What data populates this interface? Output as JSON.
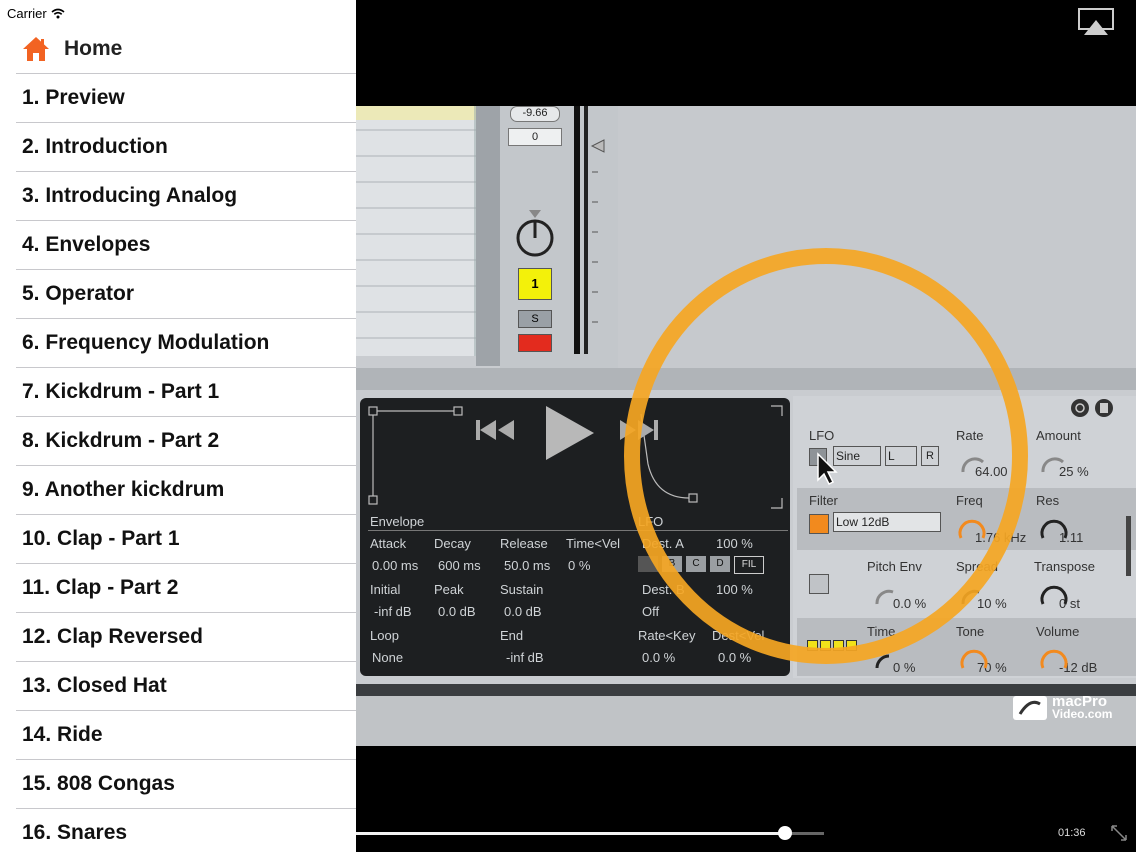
{
  "statusbar": {
    "carrier": "Carrier"
  },
  "home": {
    "label": "Home"
  },
  "nav_items": [
    "1.  Preview",
    "2.  Introduction",
    "3.  Introducing Analog",
    "4.  Envelopes",
    "5.  Operator",
    "6.  Frequency Modulation",
    "7.  Kickdrum - Part 1",
    "8.  Kickdrum - Part 2",
    "9.  Another kickdrum",
    "10. Clap - Part 1",
    "11. Clap - Part 2",
    "12. Clap Reversed",
    "13. Closed Hat",
    "14. Ride",
    "15. 808 Congas",
    "16. Snares"
  ],
  "player": {
    "time": "01:36",
    "progress": 0.552,
    "colors": {
      "accent": "#ff6a00",
      "highlight_ring": "#f5a623"
    }
  },
  "video_content": {
    "db_readout": "-9.66",
    "value_box": "0",
    "track_number": "1",
    "solo": "S",
    "envelope": {
      "title": "Envelope",
      "attack_label": "Attack",
      "attack": "0.00 ms",
      "decay_label": "Decay",
      "decay": "600 ms",
      "release_label": "Release",
      "release": "50.0 ms",
      "timevel_label": "Time<Vel",
      "timevel": "0 %",
      "initial_label": "Initial",
      "initial": "-inf dB",
      "peak_label": "Peak",
      "peak": "0.0 dB",
      "sustain_label": "Sustain",
      "sustain": "0.0 dB",
      "loop_label": "Loop",
      "loop": "None",
      "end_label": "End",
      "end": "-inf dB"
    },
    "lfo_sub": {
      "title": "LFO",
      "dest_label": "Dest. A",
      "dest_val": "100 %",
      "buttons": [
        "B",
        "C",
        "D",
        "FIL"
      ],
      "dest_b_label": "Dest. B",
      "dest_b_val": "100 %",
      "off": "Off",
      "rate_key": "Rate<Key",
      "rate_key_val": "0.0 %",
      "dest_vel": "Dest<Vel",
      "dest_vel_val": "0.0 %"
    },
    "panel": {
      "lfo": "LFO",
      "wave": "Sine",
      "channel": "L",
      "r": "R",
      "rate_label": "Rate",
      "rate": "64.00",
      "amount_label": "Amount",
      "amount": "25 %",
      "filter_label": "Filter",
      "filter_type": "Low 12dB",
      "freq_label": "Freq",
      "freq": "1.76 kHz",
      "res_label": "Res",
      "res": "1.11",
      "pitch_label": "Pitch Env",
      "pitch": "0.0 %",
      "spread_label": "Spread",
      "spread": "10 %",
      "transpose_label": "Transpose",
      "transpose": "0 st",
      "time_label": "Time",
      "time": "0 %",
      "tone_label": "Tone",
      "tone": "70 %",
      "volume_label": "Volume",
      "volume": "-12 dB"
    },
    "logo": {
      "line1": "macPro",
      "line2": "Video.com"
    }
  }
}
